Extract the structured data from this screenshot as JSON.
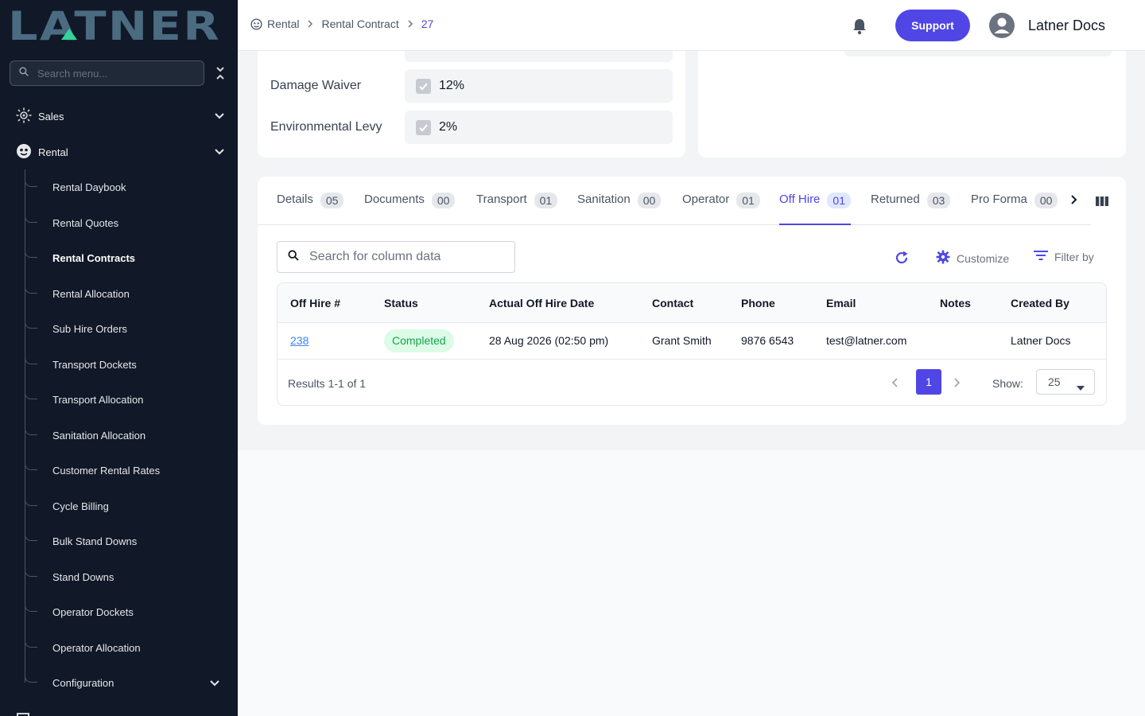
{
  "app": {
    "logo_text": "LATNER"
  },
  "sidebar": {
    "search_placeholder": "Search menu...",
    "sales_label": "Sales",
    "rental_label": "Rental",
    "rental_items": [
      "Rental Daybook",
      "Rental Quotes",
      "Rental Contracts",
      "Rental Allocation",
      "Sub Hire Orders",
      "Transport Dockets",
      "Transport Allocation",
      "Sanitation Allocation",
      "Customer Rental Rates",
      "Cycle Billing",
      "Bulk Stand Downs",
      "Stand Downs",
      "Operator Dockets",
      "Operator Allocation",
      "Configuration"
    ],
    "active_item": "Rental Contracts"
  },
  "header": {
    "breadcrumb": [
      "Rental",
      "Rental Contract",
      "27"
    ],
    "support_label": "Support",
    "user_name": "Latner Docs"
  },
  "fields": {
    "damage_waiver_label": "Damage Waiver",
    "damage_waiver_value": "12%",
    "environmental_levy_label": "Environmental Levy",
    "environmental_levy_value": "2%"
  },
  "tabs": [
    {
      "label": "Details",
      "count": "05"
    },
    {
      "label": "Documents",
      "count": "00"
    },
    {
      "label": "Transport",
      "count": "01"
    },
    {
      "label": "Sanitation",
      "count": "00"
    },
    {
      "label": "Operator",
      "count": "01"
    },
    {
      "label": "Off Hire",
      "count": "01"
    },
    {
      "label": "Returned",
      "count": "03"
    },
    {
      "label": "Pro Forma",
      "count": "00"
    }
  ],
  "active_tab": "Off Hire",
  "toolbar": {
    "search_placeholder": "Search for column data",
    "customize_label": "Customize",
    "filter_label": "Filter by"
  },
  "table": {
    "columns": [
      "Off Hire #",
      "Status",
      "Actual Off Hire Date",
      "Contact",
      "Phone",
      "Email",
      "Notes",
      "Created By"
    ],
    "rows": [
      {
        "off_hire_no": "238",
        "status": "Completed",
        "actual_off_hire_date": "28 Aug 2026 (02:50 pm)",
        "contact": "Grant Smith",
        "phone": "9876 6543",
        "email": "test@latner.com",
        "notes": "",
        "created_by": "Latner Docs"
      }
    ],
    "results_text": "Results 1-1 of 1",
    "current_page": "1",
    "show_label": "Show:",
    "page_size": "25"
  },
  "colors": {
    "sidebar_bg": "#111827",
    "accent": "#4f46e5",
    "status_completed_bg": "#dcfce7",
    "status_completed_text": "#16a34a",
    "logo": "#4b6b80",
    "logo_accent": "#34d399"
  }
}
